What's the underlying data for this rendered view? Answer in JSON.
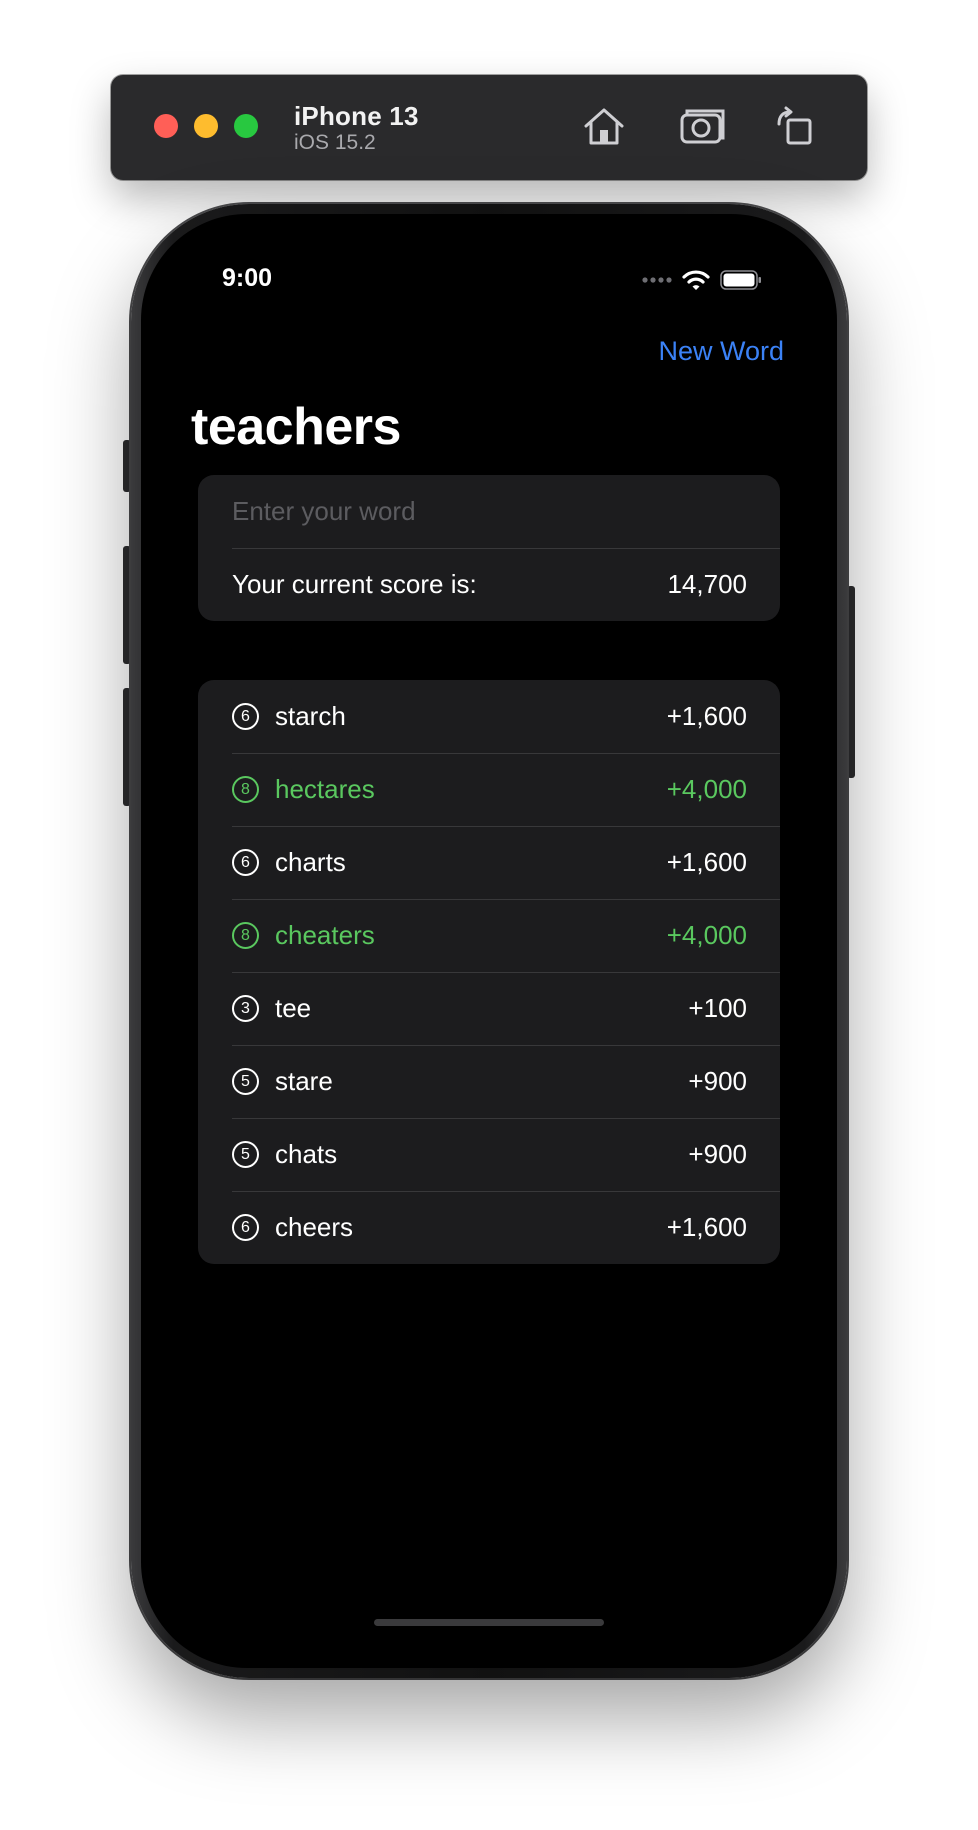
{
  "simulator": {
    "device_name": "iPhone 13",
    "os_version": "iOS 15.2",
    "home_icon": "home-icon",
    "screenshot_icon": "camera-icon",
    "rotate_icon": "rotate-icon",
    "traffic_lights": [
      "#ff5f57",
      "#febc2e",
      "#28c840"
    ]
  },
  "status_bar": {
    "time": "9:00",
    "icons": [
      "signal-dots-icon",
      "wifi-icon",
      "battery-icon"
    ]
  },
  "nav": {
    "action_label": "New Word",
    "title": "teachers"
  },
  "input": {
    "placeholder": "Enter your word",
    "value": ""
  },
  "score": {
    "label": "Your current score is:",
    "value": "14,700"
  },
  "words": [
    {
      "length": "6",
      "word": "starch",
      "points": "+1,600",
      "highlight": false
    },
    {
      "length": "8",
      "word": "hectares",
      "points": "+4,000",
      "highlight": true
    },
    {
      "length": "6",
      "word": "charts",
      "points": "+1,600",
      "highlight": false
    },
    {
      "length": "8",
      "word": "cheaters",
      "points": "+4,000",
      "highlight": true
    },
    {
      "length": "3",
      "word": "tee",
      "points": "+100",
      "highlight": false
    },
    {
      "length": "5",
      "word": "stare",
      "points": "+900",
      "highlight": false
    },
    {
      "length": "5",
      "word": "chats",
      "points": "+900",
      "highlight": false
    },
    {
      "length": "6",
      "word": "cheers",
      "points": "+1,600",
      "highlight": false
    }
  ],
  "colors": {
    "accent": "#3b82f6",
    "highlight": "#5ac85f",
    "background": "#000000",
    "group_background": "#1c1c1e"
  }
}
